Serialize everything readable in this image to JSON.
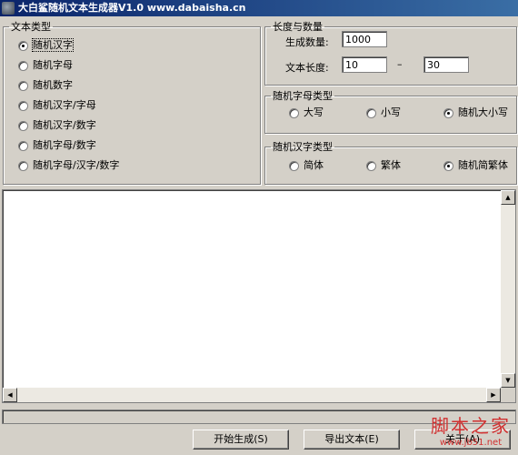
{
  "window": {
    "title": "大白鲨随机文本生成器V1.0 www.dabaisha.cn"
  },
  "text_type": {
    "legend": "文本类型",
    "options": [
      {
        "label": "随机汉字",
        "checked": true
      },
      {
        "label": "随机字母",
        "checked": false
      },
      {
        "label": "随机数字",
        "checked": false
      },
      {
        "label": "随机汉字/字母",
        "checked": false
      },
      {
        "label": "随机汉字/数字",
        "checked": false
      },
      {
        "label": "随机字母/数字",
        "checked": false
      },
      {
        "label": "随机字母/汉字/数字",
        "checked": false
      }
    ]
  },
  "length_count": {
    "legend": "长度与数量",
    "count_label": "生成数量:",
    "count_value": "1000",
    "length_label": "文本长度:",
    "length_min": "10",
    "length_separator": "–",
    "length_max": "30"
  },
  "letter_case": {
    "legend": "随机字母类型",
    "options": [
      {
        "label": "大写",
        "checked": false
      },
      {
        "label": "小写",
        "checked": false
      },
      {
        "label": "随机大小写",
        "checked": true
      }
    ]
  },
  "hanzi_type": {
    "legend": "随机汉字类型",
    "options": [
      {
        "label": "简体",
        "checked": false
      },
      {
        "label": "繁体",
        "checked": false
      },
      {
        "label": "随机简繁体",
        "checked": true
      }
    ]
  },
  "output": {
    "text": ""
  },
  "buttons": {
    "start": "开始生成(S)",
    "export": "导出文本(E)",
    "about": "关于(A)"
  },
  "watermark": {
    "big": "脚本之家",
    "small": "www.jb51.net"
  }
}
